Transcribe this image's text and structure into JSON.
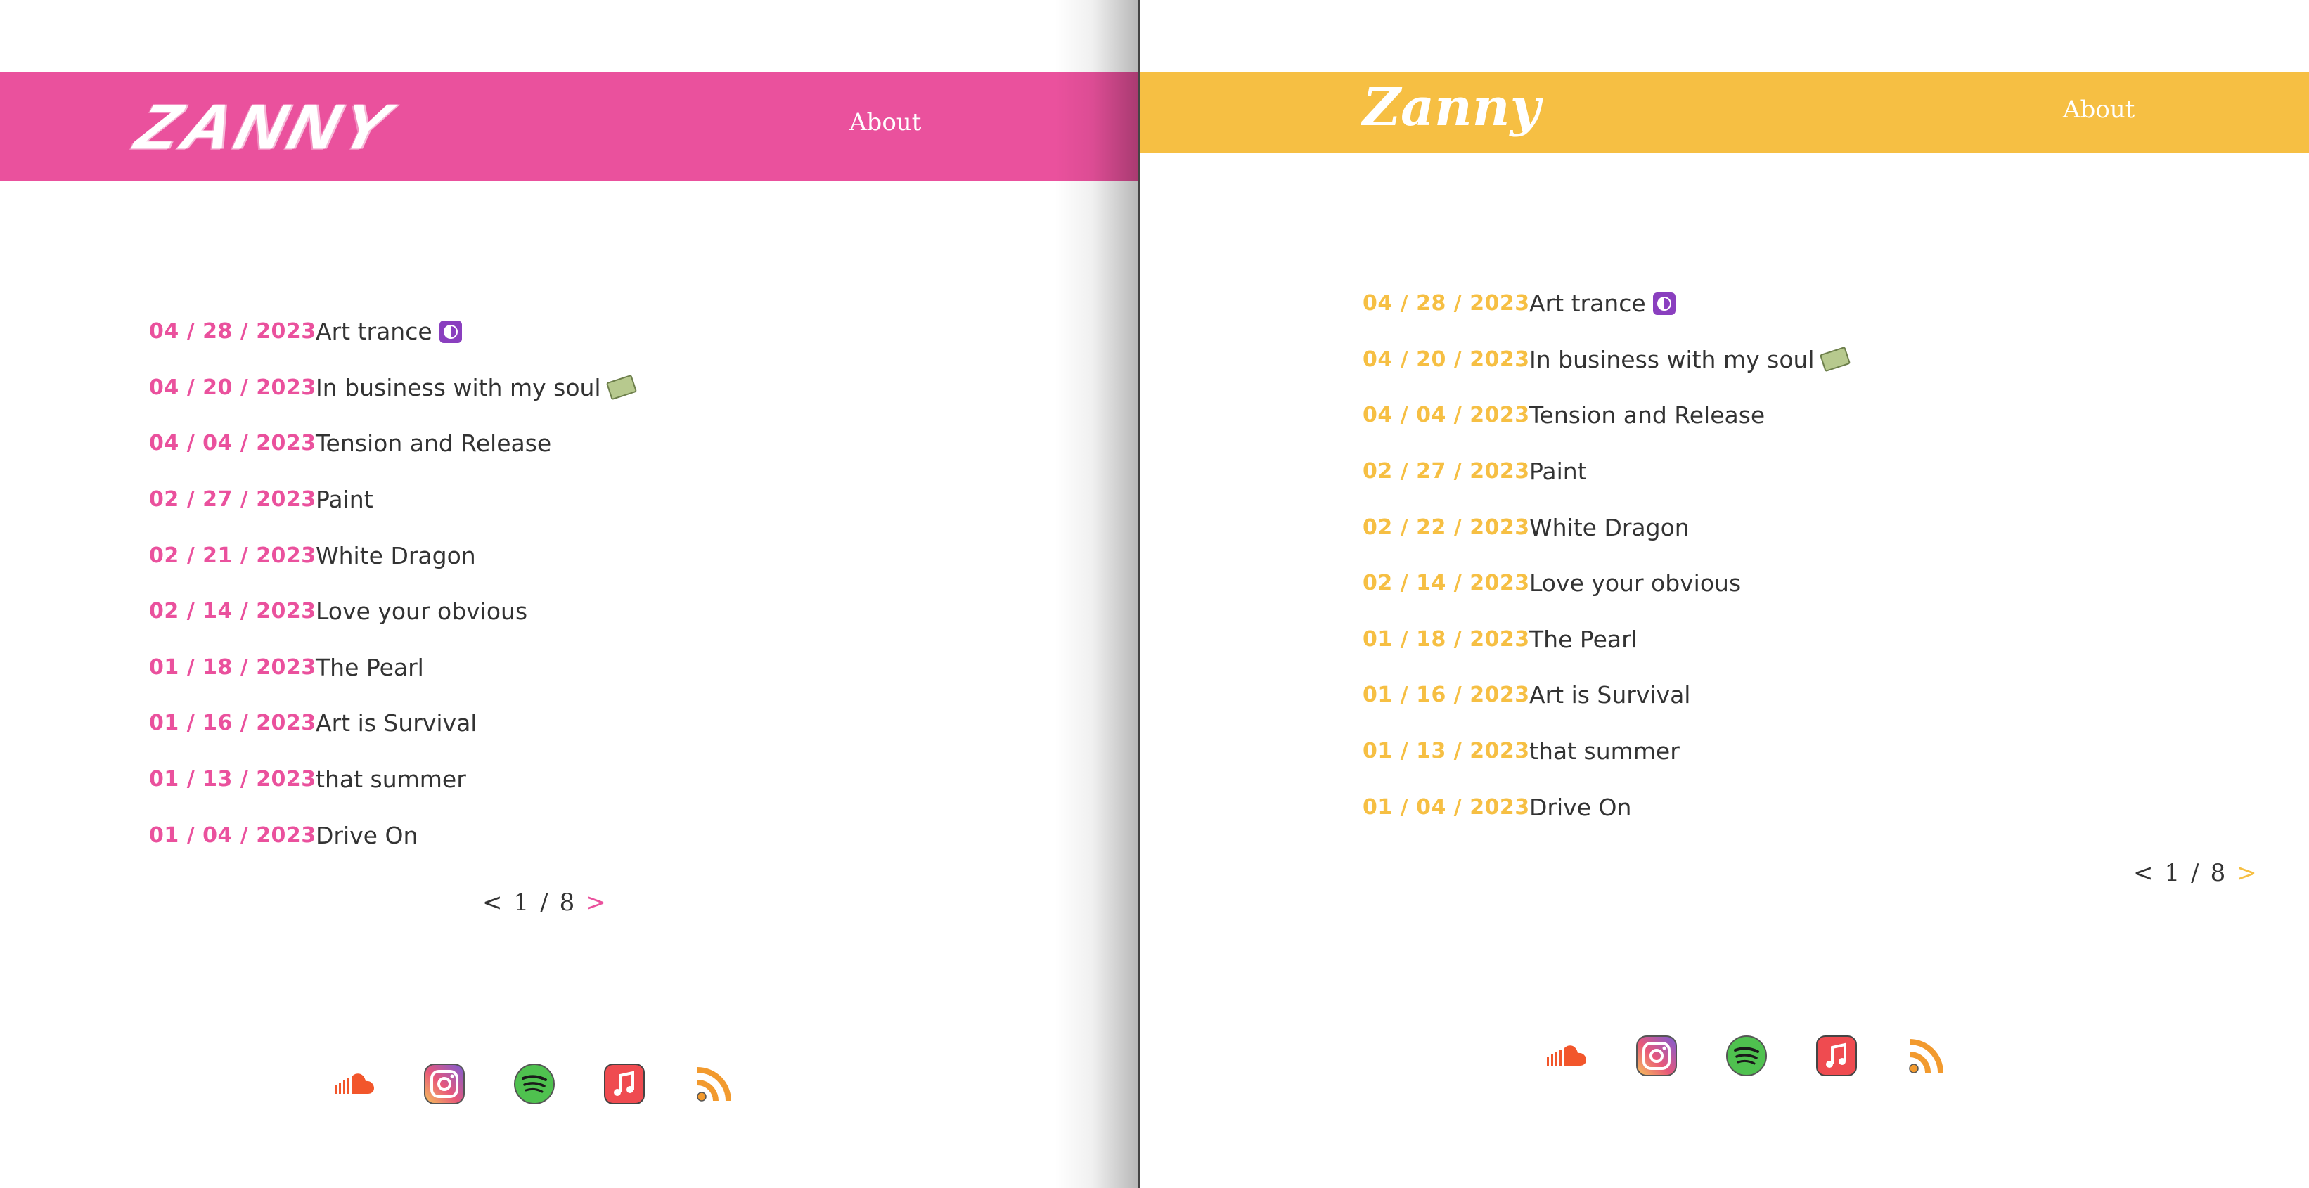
{
  "left": {
    "accent": "#ea519d",
    "logo": "ZANNY",
    "nav_about": "About",
    "posts": [
      {
        "date": "04 / 28 / 2023",
        "title": "Art trance",
        "emoji": "yin-yang"
      },
      {
        "date": "04 / 20 / 2023",
        "title": "In business with my soul",
        "emoji": "money-with-wings"
      },
      {
        "date": "04 / 04 / 2023",
        "title": "Tension and Release"
      },
      {
        "date": "02 / 27 / 2023",
        "title": "Paint"
      },
      {
        "date": "02 / 21 / 2023",
        "title": "White Dragon"
      },
      {
        "date": "02 / 14 / 2023",
        "title": "Love your obvious"
      },
      {
        "date": "01 / 18 / 2023",
        "title": "The Pearl"
      },
      {
        "date": "01 / 16 / 2023",
        "title": "Art is Survival"
      },
      {
        "date": "01 / 13 / 2023",
        "title": "that summer"
      },
      {
        "date": "01 / 04 / 2023",
        "title": "Drive On"
      }
    ],
    "pager": {
      "prev": "<",
      "current": "1",
      "separator": "/",
      "total": "8",
      "next": ">"
    }
  },
  "right": {
    "accent": "#f6bf43",
    "logo": "Zanny",
    "nav_about": "About",
    "posts": [
      {
        "date": "04 / 28 / 2023",
        "title": "Art trance",
        "emoji": "yin-yang"
      },
      {
        "date": "04 / 20 / 2023",
        "title": "In business with my soul",
        "emoji": "money-with-wings"
      },
      {
        "date": "04 / 04 / 2023",
        "title": "Tension and Release"
      },
      {
        "date": "02 / 27 / 2023",
        "title": "Paint"
      },
      {
        "date": "02 / 22 / 2023",
        "title": "White Dragon"
      },
      {
        "date": "02 / 14 / 2023",
        "title": "Love your obvious"
      },
      {
        "date": "01 / 18 / 2023",
        "title": "The Pearl"
      },
      {
        "date": "01 / 16 / 2023",
        "title": "Art is Survival"
      },
      {
        "date": "01 / 13 / 2023",
        "title": "that summer"
      },
      {
        "date": "01 / 04 / 2023",
        "title": "Drive On"
      }
    ],
    "pager": {
      "prev": "<",
      "current": "1",
      "separator": "/",
      "total": "8",
      "next": ">"
    }
  },
  "socials": [
    {
      "name": "soundcloud-icon"
    },
    {
      "name": "instagram-icon"
    },
    {
      "name": "spotify-icon"
    },
    {
      "name": "apple-music-icon"
    },
    {
      "name": "rss-feed-icon"
    }
  ],
  "colors": {
    "text": "#333333",
    "divider": "#444444"
  }
}
